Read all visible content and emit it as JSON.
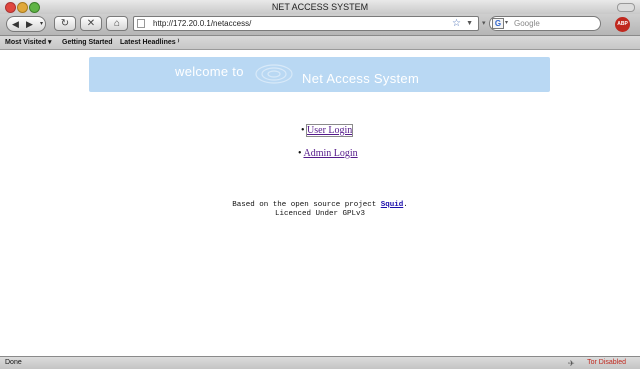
{
  "window": {
    "title": "NET ACCESS SYSTEM"
  },
  "toolbar": {
    "back_icon": "◀",
    "forward_icon": "▶",
    "reload_icon": "↻",
    "stop_icon": "✕",
    "home_icon": "⌂",
    "url": "http://172.20.0.1/netaccess/",
    "search_placeholder": "Google",
    "search_engine_letter": "G",
    "addon_badge": "ABP"
  },
  "bookmarks": {
    "items": [
      "Most Visited ▾",
      "Getting Started",
      "Latest Headlines ⁾"
    ]
  },
  "banner": {
    "welcome": "welcome to",
    "title": "Net Access System",
    "background": "#b9d8f3"
  },
  "menu": {
    "user_login": "User Login",
    "admin_login": "Admin Login"
  },
  "footer": {
    "line1_before": "Based on the open source project ",
    "line1_link": "Squid",
    "line1_after": ".",
    "line2": "Licenced Under GPLv3"
  },
  "status": {
    "left": "Done",
    "right": "Tor Disabled"
  }
}
